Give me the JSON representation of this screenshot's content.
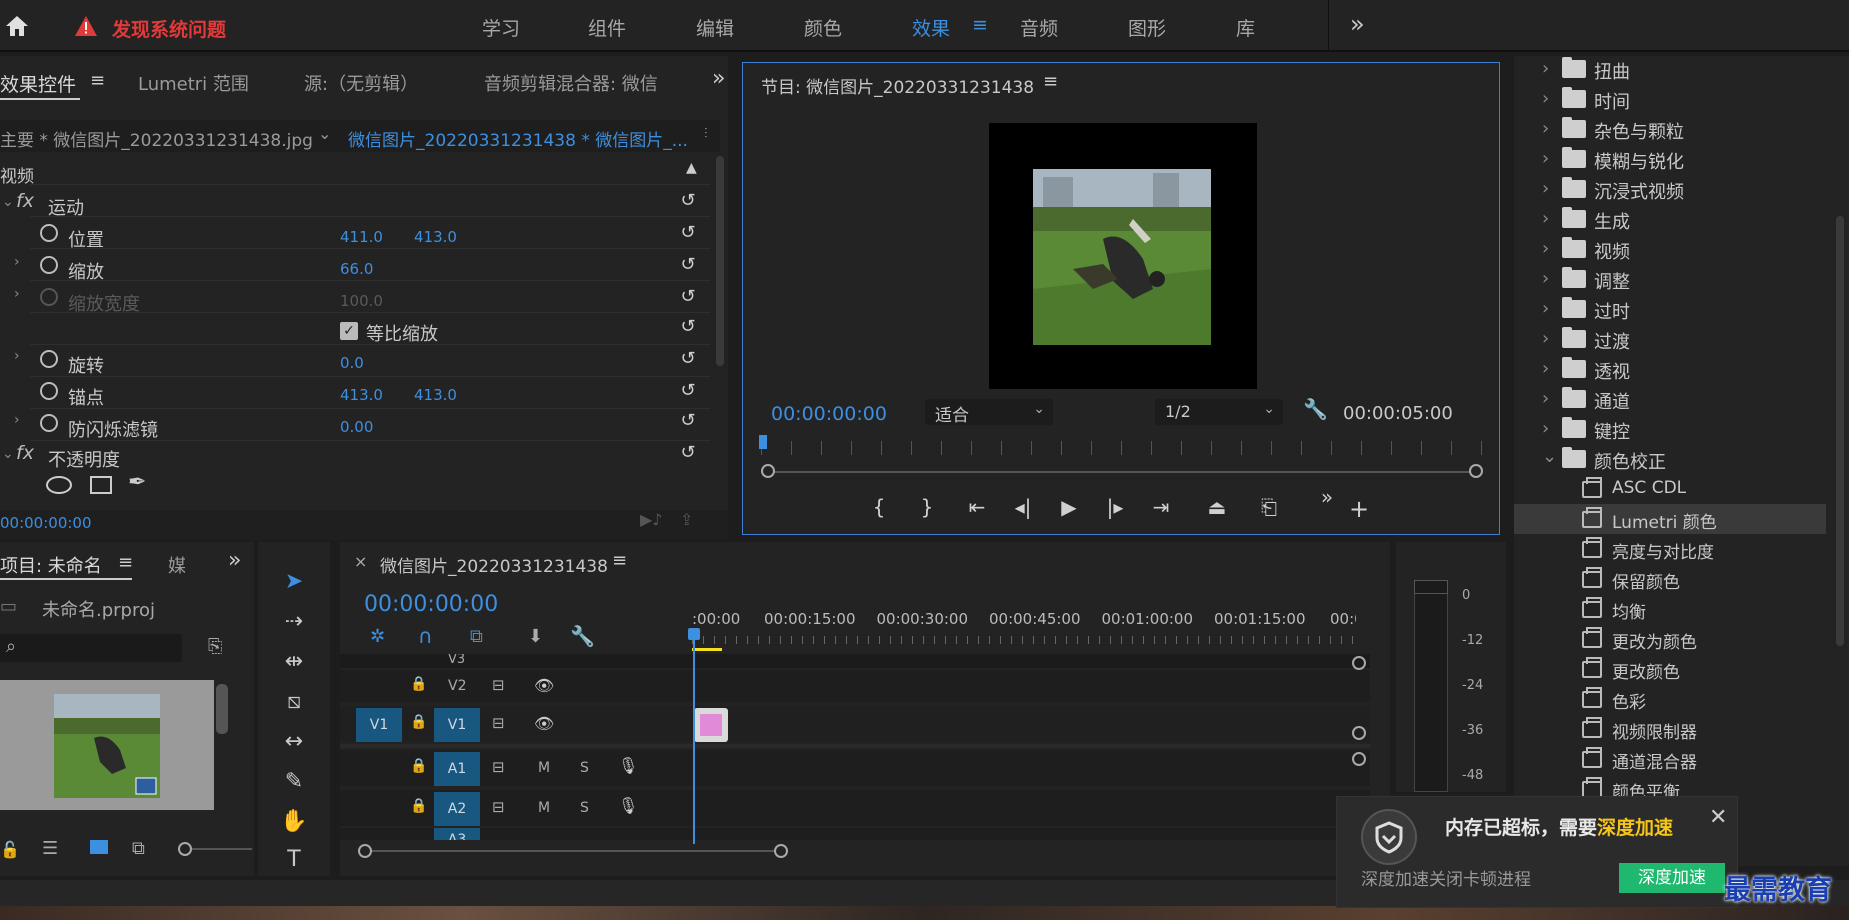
{
  "header": {
    "warning_text": "发现系统问题",
    "workspaces": [
      "学习",
      "组件",
      "编辑",
      "颜色",
      "效果",
      "音频",
      "图形",
      "库"
    ],
    "active_workspace": "效果",
    "more": "»"
  },
  "effect_controls": {
    "tabs": [
      "效果控件",
      "Lumetri 范围",
      "源:（无剪辑）",
      "音频剪辑混合器: 微信"
    ],
    "more": "»",
    "master_label": "主要 * 微信图片_20220331231438.jpg",
    "clip_label": "微信图片_20220331231438 * 微信图片_...",
    "section": "视频",
    "motion": "运动",
    "props": {
      "position": {
        "label": "位置",
        "x": "411.0",
        "y": "413.0"
      },
      "scale": {
        "label": "缩放",
        "v": "66.0"
      },
      "scale_width": {
        "label": "缩放宽度",
        "v": "100.0"
      },
      "uniform": "等比缩放",
      "rotation": {
        "label": "旋转",
        "v": "0.0"
      },
      "anchor": {
        "label": "锚点",
        "x": "413.0",
        "y": "413.0"
      },
      "antiflicker": {
        "label": "防闪烁滤镜",
        "v": "0.00"
      }
    },
    "opacity": "不透明度",
    "timecode": "00:00:00:00"
  },
  "program": {
    "title": "节目: 微信图片_20220331231438",
    "timecode": "00:00:00:00",
    "fit": "适合",
    "quality": "1/2",
    "duration": "00:00:05:00"
  },
  "project": {
    "title": "项目: 未命名",
    "tab2": "媒",
    "more": "»",
    "file": "未命名.prproj"
  },
  "timeline": {
    "title": "微信图片_20220331231438",
    "timecode": "00:00:00:00",
    "ruler": [
      ":00:00",
      "00:00:15:00",
      "00:00:30:00",
      "00:00:45:00",
      "00:01:00:00",
      "00:01:15:00",
      "00:0("
    ],
    "tracks": {
      "v3": "V3",
      "v2": "V2",
      "v1": "V1",
      "src_v1": "V1",
      "a1": "A1",
      "a2": "A2",
      "a3": "A3",
      "m": "M",
      "s": "S"
    }
  },
  "meter": {
    "labels": [
      "0",
      "-12",
      "-24",
      "-36",
      "-48"
    ]
  },
  "effects_tree": {
    "folders": [
      "扭曲",
      "时间",
      "杂色与颗粒",
      "模糊与锐化",
      "沉浸式视频",
      "生成",
      "视频",
      "调整",
      "过时",
      "过渡",
      "透视",
      "通道",
      "键控",
      "颜色校正"
    ],
    "color_items": [
      "ASC CDL",
      "Lumetri 颜色",
      "亮度与对比度",
      "保留颜色",
      "均衡",
      "更改为颜色",
      "更改颜色",
      "色彩",
      "视频限制器",
      "通道混合器",
      "颜色平衡"
    ],
    "selected": "Lumetri 颜色"
  },
  "popup": {
    "message": "内存已超标，需要",
    "highlight": "深度加速",
    "sub": "深度加速关闭卡顿进程",
    "button": "深度加速"
  },
  "watermark": "最需教育",
  "colors": {
    "accent": "#3d8fe0",
    "highlight": "#f5c518",
    "button": "#1fb86f",
    "warning": "#e03a3a"
  }
}
